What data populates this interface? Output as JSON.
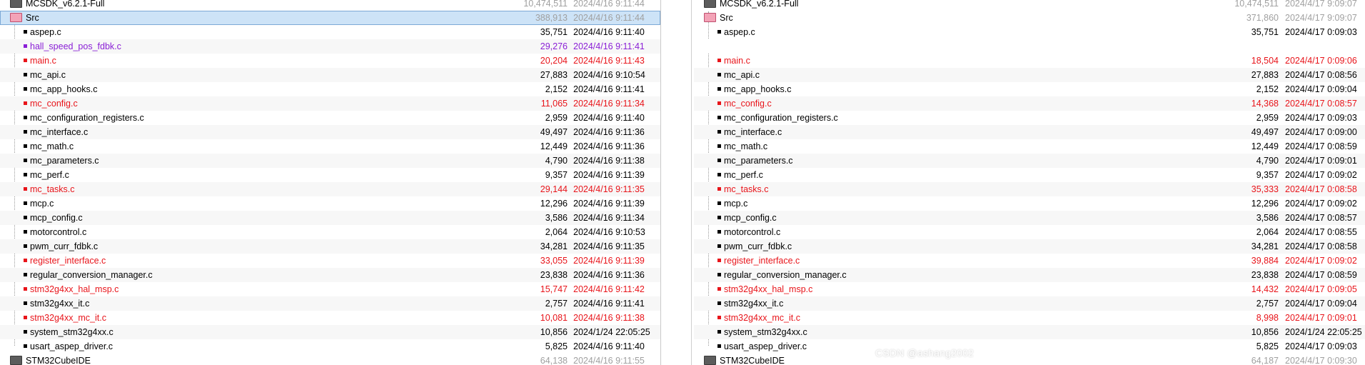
{
  "colors": {
    "changed": "#e8141a",
    "orphan": "#8a1fd6",
    "dim": "#a0a0a0",
    "selection": "#cde3f7"
  },
  "left": {
    "parent": {
      "name": "MCSDK_v6.2.1-Full",
      "size": "10,474,511",
      "date": "2024/4/16 9:11:44"
    },
    "folder": {
      "name": "Src",
      "size": "388,913",
      "date": "2024/4/16 9:11:44"
    },
    "files": [
      {
        "name": "aspep.c",
        "size": "35,751",
        "date": "2024/4/16 9:11:40",
        "status": "same"
      },
      {
        "name": "hall_speed_pos_fdbk.c",
        "size": "29,276",
        "date": "2024/4/16 9:11:41",
        "status": "orphan"
      },
      {
        "name": "main.c",
        "size": "20,204",
        "date": "2024/4/16 9:11:43",
        "status": "diff"
      },
      {
        "name": "mc_api.c",
        "size": "27,883",
        "date": "2024/4/16 9:10:54",
        "status": "same"
      },
      {
        "name": "mc_app_hooks.c",
        "size": "2,152",
        "date": "2024/4/16 9:11:41",
        "status": "same"
      },
      {
        "name": "mc_config.c",
        "size": "11,065",
        "date": "2024/4/16 9:11:34",
        "status": "diff"
      },
      {
        "name": "mc_configuration_registers.c",
        "size": "2,959",
        "date": "2024/4/16 9:11:40",
        "status": "same"
      },
      {
        "name": "mc_interface.c",
        "size": "49,497",
        "date": "2024/4/16 9:11:36",
        "status": "same"
      },
      {
        "name": "mc_math.c",
        "size": "12,449",
        "date": "2024/4/16 9:11:36",
        "status": "same"
      },
      {
        "name": "mc_parameters.c",
        "size": "4,790",
        "date": "2024/4/16 9:11:38",
        "status": "same"
      },
      {
        "name": "mc_perf.c",
        "size": "9,357",
        "date": "2024/4/16 9:11:39",
        "status": "same"
      },
      {
        "name": "mc_tasks.c",
        "size": "29,144",
        "date": "2024/4/16 9:11:35",
        "status": "diff"
      },
      {
        "name": "mcp.c",
        "size": "12,296",
        "date": "2024/4/16 9:11:39",
        "status": "same"
      },
      {
        "name": "mcp_config.c",
        "size": "3,586",
        "date": "2024/4/16 9:11:34",
        "status": "same"
      },
      {
        "name": "motorcontrol.c",
        "size": "2,064",
        "date": "2024/4/16 9:10:53",
        "status": "same"
      },
      {
        "name": "pwm_curr_fdbk.c",
        "size": "34,281",
        "date": "2024/4/16 9:11:35",
        "status": "same"
      },
      {
        "name": "register_interface.c",
        "size": "33,055",
        "date": "2024/4/16 9:11:39",
        "status": "diff"
      },
      {
        "name": "regular_conversion_manager.c",
        "size": "23,838",
        "date": "2024/4/16 9:11:36",
        "status": "same"
      },
      {
        "name": "stm32g4xx_hal_msp.c",
        "size": "15,747",
        "date": "2024/4/16 9:11:42",
        "status": "diff"
      },
      {
        "name": "stm32g4xx_it.c",
        "size": "2,757",
        "date": "2024/4/16 9:11:41",
        "status": "same"
      },
      {
        "name": "stm32g4xx_mc_it.c",
        "size": "10,081",
        "date": "2024/4/16 9:11:38",
        "status": "diff"
      },
      {
        "name": "system_stm32g4xx.c",
        "size": "10,856",
        "date": "2024/1/24 22:05:25",
        "status": "same"
      },
      {
        "name": "usart_aspep_driver.c",
        "size": "5,825",
        "date": "2024/4/16 9:11:40",
        "status": "same"
      }
    ],
    "next_folder": {
      "name": "STM32CubeIDE",
      "size": "64,138",
      "date": "2024/4/16 9:11:55"
    }
  },
  "right": {
    "parent": {
      "name": "MCSDK_v6.2.1-Full",
      "size": "10,474,511",
      "date": "2024/4/17 9:09:07"
    },
    "folder": {
      "name": "Src",
      "size": "371,860",
      "date": "2024/4/17 9:09:07"
    },
    "files": [
      {
        "name": "aspep.c",
        "size": "35,751",
        "date": "2024/4/17 0:09:03",
        "status": "same"
      },
      {
        "name": "",
        "size": "",
        "date": "",
        "status": "empty"
      },
      {
        "name": "main.c",
        "size": "18,504",
        "date": "2024/4/17 0:09:06",
        "status": "diff"
      },
      {
        "name": "mc_api.c",
        "size": "27,883",
        "date": "2024/4/17 0:08:56",
        "status": "same"
      },
      {
        "name": "mc_app_hooks.c",
        "size": "2,152",
        "date": "2024/4/17 0:09:04",
        "status": "same"
      },
      {
        "name": "mc_config.c",
        "size": "14,368",
        "date": "2024/4/17 0:08:57",
        "status": "diff"
      },
      {
        "name": "mc_configuration_registers.c",
        "size": "2,959",
        "date": "2024/4/17 0:09:03",
        "status": "same"
      },
      {
        "name": "mc_interface.c",
        "size": "49,497",
        "date": "2024/4/17 0:09:00",
        "status": "same"
      },
      {
        "name": "mc_math.c",
        "size": "12,449",
        "date": "2024/4/17 0:08:59",
        "status": "same"
      },
      {
        "name": "mc_parameters.c",
        "size": "4,790",
        "date": "2024/4/17 0:09:01",
        "status": "same"
      },
      {
        "name": "mc_perf.c",
        "size": "9,357",
        "date": "2024/4/17 0:09:02",
        "status": "same"
      },
      {
        "name": "mc_tasks.c",
        "size": "35,333",
        "date": "2024/4/17 0:08:58",
        "status": "diff"
      },
      {
        "name": "mcp.c",
        "size": "12,296",
        "date": "2024/4/17 0:09:02",
        "status": "same"
      },
      {
        "name": "mcp_config.c",
        "size": "3,586",
        "date": "2024/4/17 0:08:57",
        "status": "same"
      },
      {
        "name": "motorcontrol.c",
        "size": "2,064",
        "date": "2024/4/17 0:08:55",
        "status": "same"
      },
      {
        "name": "pwm_curr_fdbk.c",
        "size": "34,281",
        "date": "2024/4/17 0:08:58",
        "status": "same"
      },
      {
        "name": "register_interface.c",
        "size": "39,884",
        "date": "2024/4/17 0:09:02",
        "status": "diff"
      },
      {
        "name": "regular_conversion_manager.c",
        "size": "23,838",
        "date": "2024/4/17 0:08:59",
        "status": "same"
      },
      {
        "name": "stm32g4xx_hal_msp.c",
        "size": "14,432",
        "date": "2024/4/17 0:09:05",
        "status": "diff"
      },
      {
        "name": "stm32g4xx_it.c",
        "size": "2,757",
        "date": "2024/4/17 0:09:04",
        "status": "same"
      },
      {
        "name": "stm32g4xx_mc_it.c",
        "size": "8,998",
        "date": "2024/4/17 0:09:01",
        "status": "diff"
      },
      {
        "name": "system_stm32g4xx.c",
        "size": "10,856",
        "date": "2024/1/24 22:05:25",
        "status": "same"
      },
      {
        "name": "usart_aspep_driver.c",
        "size": "5,825",
        "date": "2024/4/17 0:09:03",
        "status": "same"
      }
    ],
    "next_folder": {
      "name": "STM32CubeIDE",
      "size": "64,187",
      "date": "2024/4/17 0:09:30"
    }
  },
  "watermark": "CSDN @ashang2002"
}
